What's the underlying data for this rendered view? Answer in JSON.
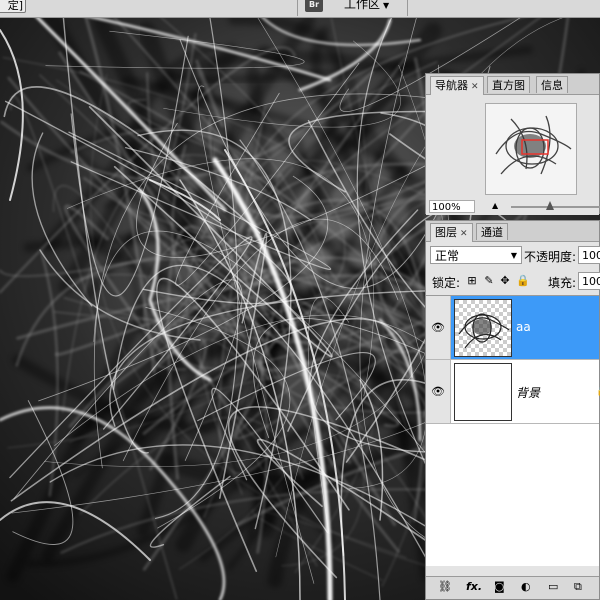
{
  "topbar": {
    "cut_button_label": "定]",
    "bridge_icon": "Br",
    "workspace_label": "工作区",
    "workspace_arrow": "▼"
  },
  "navigator_panel": {
    "tabs": [
      {
        "label": "导航器",
        "active": true
      },
      {
        "label": "直方图",
        "active": false
      },
      {
        "label": "信息",
        "active": false
      }
    ],
    "zoom_value": "100%",
    "view_box_color": "#e8342c"
  },
  "layers_panel": {
    "tabs": [
      {
        "label": "图层",
        "active": true
      },
      {
        "label": "通道",
        "active": false
      }
    ],
    "blend_mode": "正常",
    "opacity_label": "不透明度:",
    "opacity_value": "100",
    "lock_label": "锁定:",
    "fill_label": "填充:",
    "fill_value": "100",
    "layers": [
      {
        "name": "aa",
        "selected": true,
        "visible": true
      },
      {
        "name": "背景",
        "selected": false,
        "visible": true,
        "locked": true
      }
    ],
    "bottom_icons": [
      "link-icon",
      "fx-icon",
      "mask-icon",
      "adjustment-icon",
      "folder-icon",
      "new-layer-icon"
    ],
    "bottom_fx_label": "fx."
  },
  "colors": {
    "selection_blue": "#3d9af8",
    "panel_bg": "#e4e4e4"
  }
}
